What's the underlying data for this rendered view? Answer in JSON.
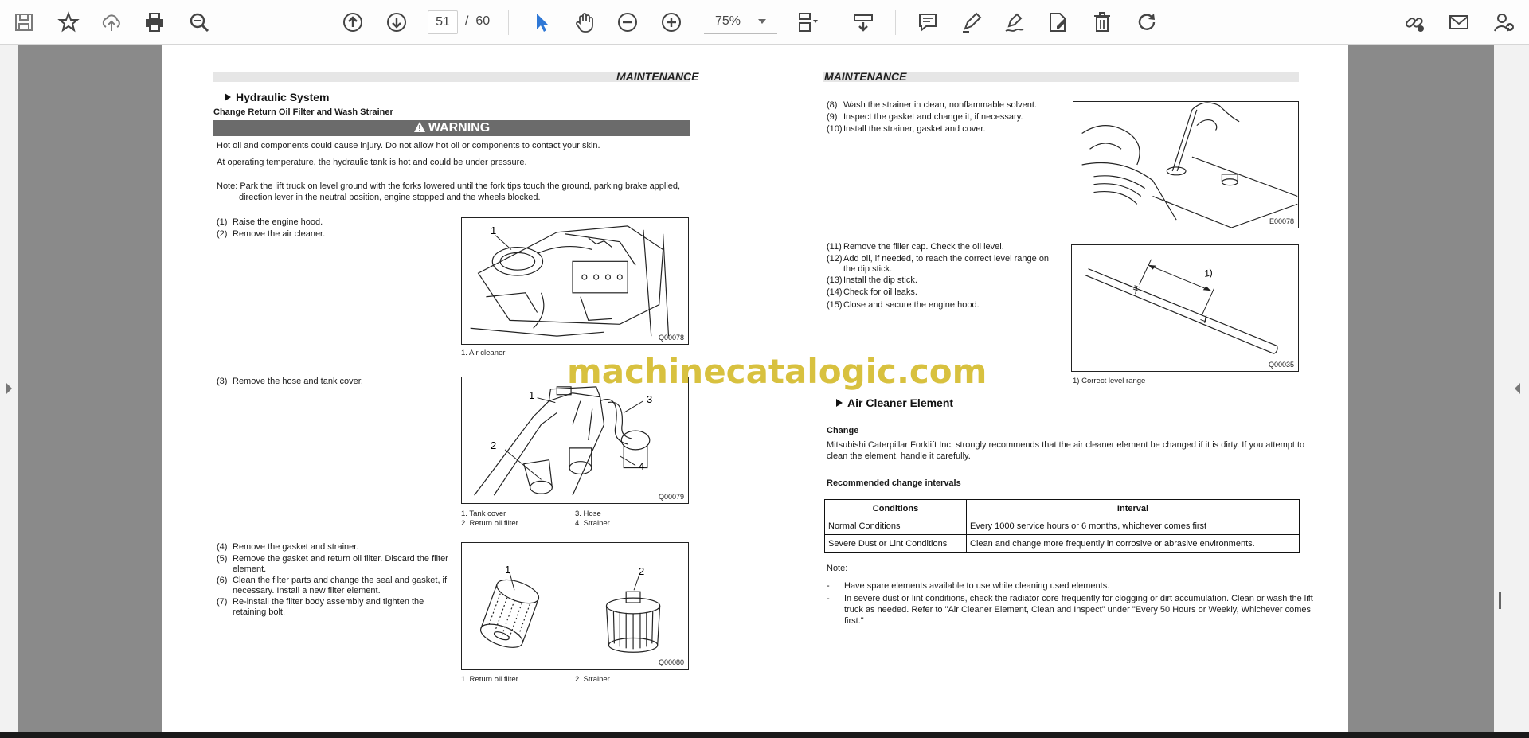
{
  "toolbar": {
    "page_current": "51",
    "page_separator": "/",
    "page_total": "60",
    "zoom": "75%"
  },
  "watermark": "machinecatalogic.com",
  "left_page": {
    "header": "MAINTENANCE",
    "section_title": "Hydraulic System",
    "subsection_title": "Change Return Oil Filter and Wash Strainer",
    "warning_label": "WARNING",
    "warning_lines": [
      "Hot oil and components could cause injury. Do not allow hot oil or components to contact your skin.",
      "At operating temperature, the hydraulic tank is hot and could be under pressure."
    ],
    "note_lines": [
      "Note: Park the lift truck on level ground with the forks lowered until the fork tips touch the ground, parking brake applied,",
      "direction lever in the neutral position, engine stopped and the wheels blocked."
    ],
    "steps_a": [
      {
        "num": "(1)",
        "text": "Raise the engine hood."
      },
      {
        "num": "(2)",
        "text": "Remove the air cleaner."
      }
    ],
    "fig1": {
      "code": "Q00078",
      "label": "1",
      "caption": "1. Air cleaner"
    },
    "steps_b": [
      {
        "num": "(3)",
        "text": "Remove the hose and tank cover."
      }
    ],
    "fig2": {
      "code": "Q00079",
      "labels": [
        "1",
        "2",
        "3",
        "4"
      ],
      "captions": [
        "1. Tank cover",
        "2. Return oil filter",
        "3. Hose",
        "4. Strainer"
      ]
    },
    "steps_c": [
      {
        "num": "(4)",
        "text": "Remove the gasket and strainer."
      },
      {
        "num": "(5)",
        "text": "Remove the gasket and return oil filter. Discard the filter",
        "text2": "element."
      },
      {
        "num": "(6)",
        "text": "Clean the filter parts and change the seal and gasket, if",
        "text2": "necessary. Install a new filter element."
      },
      {
        "num": "(7)",
        "text": "Re-install the filter body assembly and tighten the",
        "text2": "retaining bolt."
      }
    ],
    "fig3": {
      "code": "Q00080",
      "labels": [
        "1",
        "2"
      ],
      "captions": [
        "1. Return oil filter",
        "2. Strainer"
      ]
    }
  },
  "right_page": {
    "header": "MAINTENANCE",
    "steps_a": [
      {
        "num": "(8)",
        "text": "Wash the strainer in clean, nonflammable solvent."
      },
      {
        "num": "(9)",
        "text": "Inspect the gasket and change it, if necessary."
      },
      {
        "num": "(10)",
        "text": "Install the strainer, gasket and cover."
      }
    ],
    "fig4": {
      "code": "E00078"
    },
    "steps_b": [
      {
        "num": "(11)",
        "text": "Remove the filler cap. Check the oil level."
      },
      {
        "num": "(12)",
        "text": "Add oil, if needed, to reach the correct level range on",
        "text2": "the dip stick."
      },
      {
        "num": "(13)",
        "text": "Install the dip stick."
      },
      {
        "num": "(14)",
        "text": "Check for oil leaks."
      },
      {
        "num": "(15)",
        "text": "Close and secure the engine hood."
      }
    ],
    "fig5": {
      "code": "Q00035",
      "label": "1)",
      "caption": "1) Correct level range"
    },
    "section_title": "Air Cleaner Element",
    "change_heading": "Change",
    "change_lines": [
      "Mitsubishi Caterpillar Forklift Inc. strongly recommends that the air cleaner element be changed if it is dirty. If you attempt to",
      "clean the element, handle it carefully."
    ],
    "intervals_heading": "Recommended change intervals",
    "table": {
      "headers": [
        "Conditions",
        "Interval"
      ],
      "rows": [
        [
          "Normal Conditions",
          "Every 1000 service hours or 6 months, whichever comes first"
        ],
        [
          "Severe Dust or Lint Conditions",
          "Clean and change more frequently in corrosive or abrasive environments."
        ]
      ]
    },
    "note_label": "Note:",
    "notes": [
      {
        "dash": "-",
        "lines": [
          "Have spare elements available to use while cleaning used elements."
        ]
      },
      {
        "dash": "-",
        "lines": [
          "In severe dust or lint conditions, check the radiator core frequently for clogging or dirt accumulation. Clean or wash the lift",
          "truck as needed. Refer to \"Air Cleaner Element, Clean and Inspect\" under \"Every 50 Hours or Weekly, Whichever comes",
          "first.\""
        ]
      }
    ]
  }
}
